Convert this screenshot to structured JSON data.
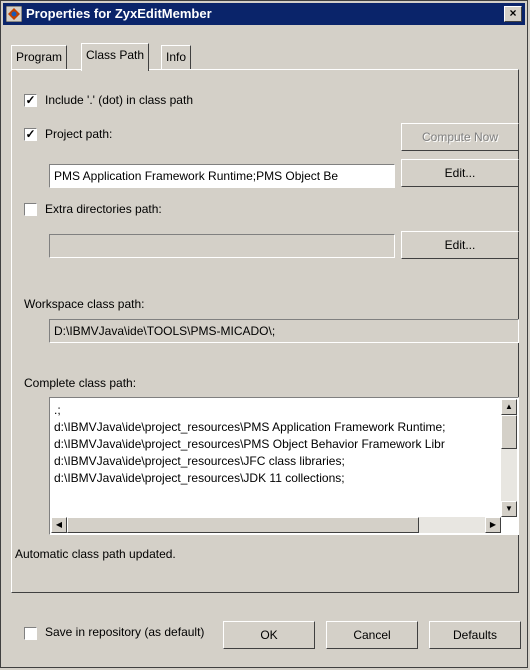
{
  "window": {
    "title": "Properties for ZyxEditMember",
    "close_label": "×"
  },
  "tabs": [
    {
      "label": "Program",
      "active": false
    },
    {
      "label": "Class Path",
      "active": true
    },
    {
      "label": "Info",
      "active": false
    }
  ],
  "options": {
    "include_dot": {
      "label": "Include '.' (dot) in class path",
      "checked": true
    },
    "project_path": {
      "label": "Project path:",
      "checked": true,
      "value": "PMS Application Framework Runtime;PMS Object Be"
    },
    "extra_dirs": {
      "label": "Extra directories path:",
      "checked": false,
      "value": ""
    }
  },
  "buttons": {
    "compute_now": "Compute Now",
    "edit_project": "Edit...",
    "edit_extra": "Edit...",
    "ok": "OK",
    "cancel": "Cancel",
    "defaults": "Defaults"
  },
  "workspace": {
    "label": "Workspace class path:",
    "value": "D:\\IBMVJava\\ide\\TOOLS\\PMS-MICADO\\;"
  },
  "complete": {
    "label": "Complete class path:",
    "lines": [
      ".;",
      "d:\\IBMVJava\\ide\\project_resources\\PMS Application Framework Runtime;",
      "d:\\IBMVJava\\ide\\project_resources\\PMS Object Behavior Framework Libr",
      "d:\\IBMVJava\\ide\\project_resources\\JFC class libraries;",
      "d:\\IBMVJava\\ide\\project_resources\\JDK 11 collections;"
    ]
  },
  "status": "Automatic class path updated.",
  "save_repo": {
    "label": "Save in repository (as default)",
    "checked": false
  },
  "colors": {
    "titlebar": "#0a246a",
    "face": "#d4d0c8"
  }
}
